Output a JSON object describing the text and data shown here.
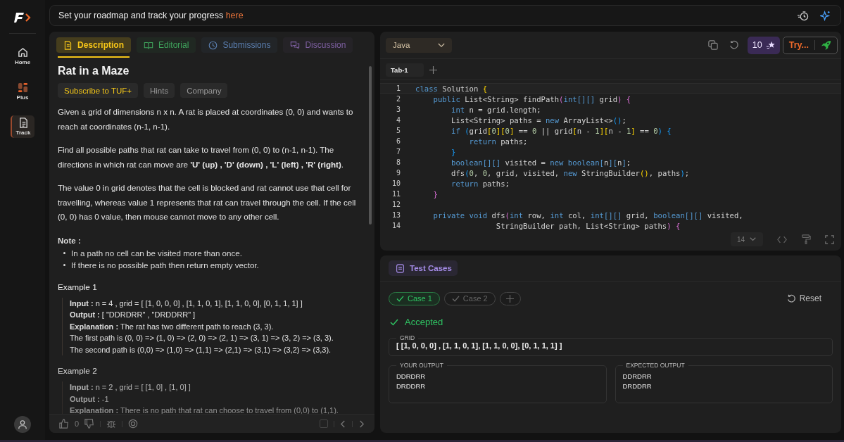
{
  "sidebar": {
    "items": [
      {
        "label": "Home",
        "selected": false
      },
      {
        "label": "Plus",
        "selected": false
      },
      {
        "label": "Track",
        "selected": true
      }
    ]
  },
  "banner": {
    "text": "Set your roadmap and track your progress",
    "link": "here"
  },
  "problem_tabs": [
    {
      "label": "Description",
      "color": "#f5c518",
      "selected": true
    },
    {
      "label": "Editorial",
      "color": "#3fa35c",
      "selected": false
    },
    {
      "label": "Submissions",
      "color": "#5b7fb0",
      "selected": false
    },
    {
      "label": "Discussion",
      "color": "#7d5fa0",
      "selected": false
    }
  ],
  "problem": {
    "title": "Rat in a Maze",
    "tags": [
      {
        "label": "Subscribe to TUF+",
        "kind": "premium"
      },
      {
        "label": "Hints",
        "kind": "plain"
      },
      {
        "label": "Company",
        "kind": "plain"
      }
    ],
    "paragraphs": [
      "Given a grid of dimensions n x n. A rat is placed at coordinates (0, 0) and wants to reach at coordinates (n-1, n-1).",
      "Find all possible paths that rat can take to travel from (0, 0) to (n-1, n-1). The directions in which rat can move are **'U' (up) , 'D' (down) , 'L' (left) , 'R' (right)**.",
      "The value 0 in grid denotes that the cell is blocked and rat cannot use that cell for travelling, whereas value 1 represents that rat can travel through the cell. If the cell (0, 0) has 0 value, then mouse cannot move to any other cell."
    ],
    "note_title": "Note :",
    "notes": [
      "In a path no cell can be visited more than once.",
      "If there is no possible path then return empty vector."
    ],
    "examples": [
      {
        "title": "Example 1",
        "lines": [
          "**Input :** n = 4 , grid = [ [1, 0, 0, 0] , [1, 1, 0, 1], [1, 1, 0, 0], [0, 1, 1, 1] ]",
          "**Output :** [ \"DDRDRR\" , \"DRDDRR\" ]",
          "**Explanation :** The rat has two different path to reach (3, 3).",
          "The first path is (0, 0) => (1, 0) => (2, 0) => (2, 1) => (3, 1) => (3, 2) => (3, 3).",
          "The second path is (0,0) => (1,0) => (1,1) => (2,1) => (3,1) => (3,2) => (3,3)."
        ]
      },
      {
        "title": "Example 2",
        "lines": [
          "**Input :** n = 2 , grid = [ [1, 0] , [1, 0] ]",
          "**Output :** -1",
          "**Explanation :** There is no path that rat can choose to travel from (0,0) to (1,1)."
        ]
      }
    ]
  },
  "problem_footer": {
    "likes": "0",
    "checked": false
  },
  "editor": {
    "language": "Java",
    "credits": "10",
    "try_button": "Try...",
    "tabs": [
      {
        "label": "Tab-1",
        "selected": true
      }
    ],
    "font_size": "14",
    "code": [
      {
        "number": "1",
        "tokens": [
          {
            "text": "class",
            "kind": "kw"
          },
          {
            "text": " Solution ",
            "kind": "plain"
          },
          {
            "text": "{",
            "kind": "b1"
          }
        ]
      },
      {
        "number": "2",
        "tokens": [
          {
            "text": "    public",
            "kind": "kw"
          },
          {
            "text": " List<String> findPath",
            "kind": "plain"
          },
          {
            "text": "(",
            "kind": "b2"
          },
          {
            "text": "int[][]",
            "kind": "kw"
          },
          {
            "text": " grid",
            "kind": "plain"
          },
          {
            "text": ")",
            "kind": "b2"
          },
          {
            "text": " {",
            "kind": "b2"
          }
        ]
      },
      {
        "number": "3",
        "tokens": [
          {
            "text": "        int",
            "kind": "kw"
          },
          {
            "text": " n = grid.length;",
            "kind": "plain"
          }
        ]
      },
      {
        "number": "4",
        "tokens": [
          {
            "text": "        List<String> paths = ",
            "kind": "plain"
          },
          {
            "text": "new",
            "kind": "kw"
          },
          {
            "text": " ArrayList<>",
            "kind": "plain"
          },
          {
            "text": "()",
            "kind": "b3"
          },
          {
            "text": ";",
            "kind": "plain"
          }
        ]
      },
      {
        "number": "5",
        "tokens": [
          {
            "text": "        if",
            "kind": "kw"
          },
          {
            "text": " (",
            "kind": "b3"
          },
          {
            "text": "grid",
            "kind": "plain"
          },
          {
            "text": "[",
            "kind": "b1"
          },
          {
            "text": "0",
            "kind": "num"
          },
          {
            "text": "][",
            "kind": "b1"
          },
          {
            "text": "0",
            "kind": "num"
          },
          {
            "text": "]",
            "kind": "b1"
          },
          {
            "text": " == ",
            "kind": "plain"
          },
          {
            "text": "0",
            "kind": "num"
          },
          {
            "text": " || grid",
            "kind": "plain"
          },
          {
            "text": "[",
            "kind": "b1"
          },
          {
            "text": "n - ",
            "kind": "plain"
          },
          {
            "text": "1",
            "kind": "num"
          },
          {
            "text": "][",
            "kind": "b1"
          },
          {
            "text": "n - ",
            "kind": "plain"
          },
          {
            "text": "1",
            "kind": "num"
          },
          {
            "text": "]",
            "kind": "b1"
          },
          {
            "text": " == ",
            "kind": "plain"
          },
          {
            "text": "0",
            "kind": "num"
          },
          {
            "text": ")",
            "kind": "b3"
          },
          {
            "text": " {",
            "kind": "b3"
          }
        ]
      },
      {
        "number": "6",
        "tokens": [
          {
            "text": "            return",
            "kind": "kw"
          },
          {
            "text": " paths;",
            "kind": "plain"
          }
        ]
      },
      {
        "number": "7",
        "tokens": [
          {
            "text": "        }",
            "kind": "b3"
          }
        ]
      },
      {
        "number": "8",
        "tokens": [
          {
            "text": "        boolean[][]",
            "kind": "kw"
          },
          {
            "text": " visited = ",
            "kind": "plain"
          },
          {
            "text": "new boolean[",
            "kind": "kw"
          },
          {
            "text": "n",
            "kind": "plain"
          },
          {
            "text": "][",
            "kind": "kw"
          },
          {
            "text": "n",
            "kind": "plain"
          },
          {
            "text": "]",
            "kind": "kw"
          },
          {
            "text": ";",
            "kind": "plain"
          }
        ]
      },
      {
        "number": "9",
        "tokens": [
          {
            "text": "        dfs",
            "kind": "plain"
          },
          {
            "text": "(",
            "kind": "b3"
          },
          {
            "text": "0",
            "kind": "num"
          },
          {
            "text": ", ",
            "kind": "plain"
          },
          {
            "text": "0",
            "kind": "num"
          },
          {
            "text": ", grid, visited, ",
            "kind": "plain"
          },
          {
            "text": "new",
            "kind": "kw"
          },
          {
            "text": " StringBuilder",
            "kind": "plain"
          },
          {
            "text": "()",
            "kind": "b1"
          },
          {
            "text": ", paths",
            "kind": "plain"
          },
          {
            "text": ")",
            "kind": "b3"
          },
          {
            "text": ";",
            "kind": "plain"
          }
        ]
      },
      {
        "number": "10",
        "tokens": [
          {
            "text": "        return",
            "kind": "kw"
          },
          {
            "text": " paths;",
            "kind": "plain"
          }
        ]
      },
      {
        "number": "11",
        "tokens": [
          {
            "text": "    }",
            "kind": "b2"
          }
        ]
      },
      {
        "number": "12"
      },
      {
        "number": "13",
        "tokens": [
          {
            "text": "    private void",
            "kind": "kw"
          },
          {
            "text": " dfs",
            "kind": "plain"
          },
          {
            "text": "(",
            "kind": "b2"
          },
          {
            "text": "int",
            "kind": "kw"
          },
          {
            "text": " row, ",
            "kind": "plain"
          },
          {
            "text": "int",
            "kind": "kw"
          },
          {
            "text": " col, ",
            "kind": "plain"
          },
          {
            "text": "int[][]",
            "kind": "kw"
          },
          {
            "text": " grid, ",
            "kind": "plain"
          },
          {
            "text": "boolean[][]",
            "kind": "kw"
          },
          {
            "text": " visited,",
            "kind": "plain"
          }
        ]
      },
      {
        "number": "14",
        "tokens": [
          {
            "text": "                  StringBuilder path, List<String> paths",
            "kind": "plain"
          },
          {
            "text": ")",
            "kind": "b2"
          },
          {
            "text": " {",
            "kind": "b2"
          }
        ]
      }
    ]
  },
  "test_panel": {
    "title": "Test Cases",
    "cases": [
      {
        "label": "Case 1",
        "selected": true
      },
      {
        "label": "Case 2",
        "selected": false
      }
    ],
    "reset": "Reset",
    "verdict": "Accepted",
    "fields": [
      {
        "label": "GRID",
        "lines": [
          "[ [1, 0, 0, 0] , [1, 1, 0, 1], [1, 1, 0, 0], [0, 1, 1, 1] ]"
        ]
      }
    ],
    "outputs": [
      {
        "label": "YOUR OUTPUT",
        "lines": [
          "DDRDRR",
          "DRDDRR"
        ]
      },
      {
        "label": "EXPECTED OUTPUT",
        "lines": [
          "DDRDRR",
          "DRDDRR"
        ]
      }
    ]
  }
}
